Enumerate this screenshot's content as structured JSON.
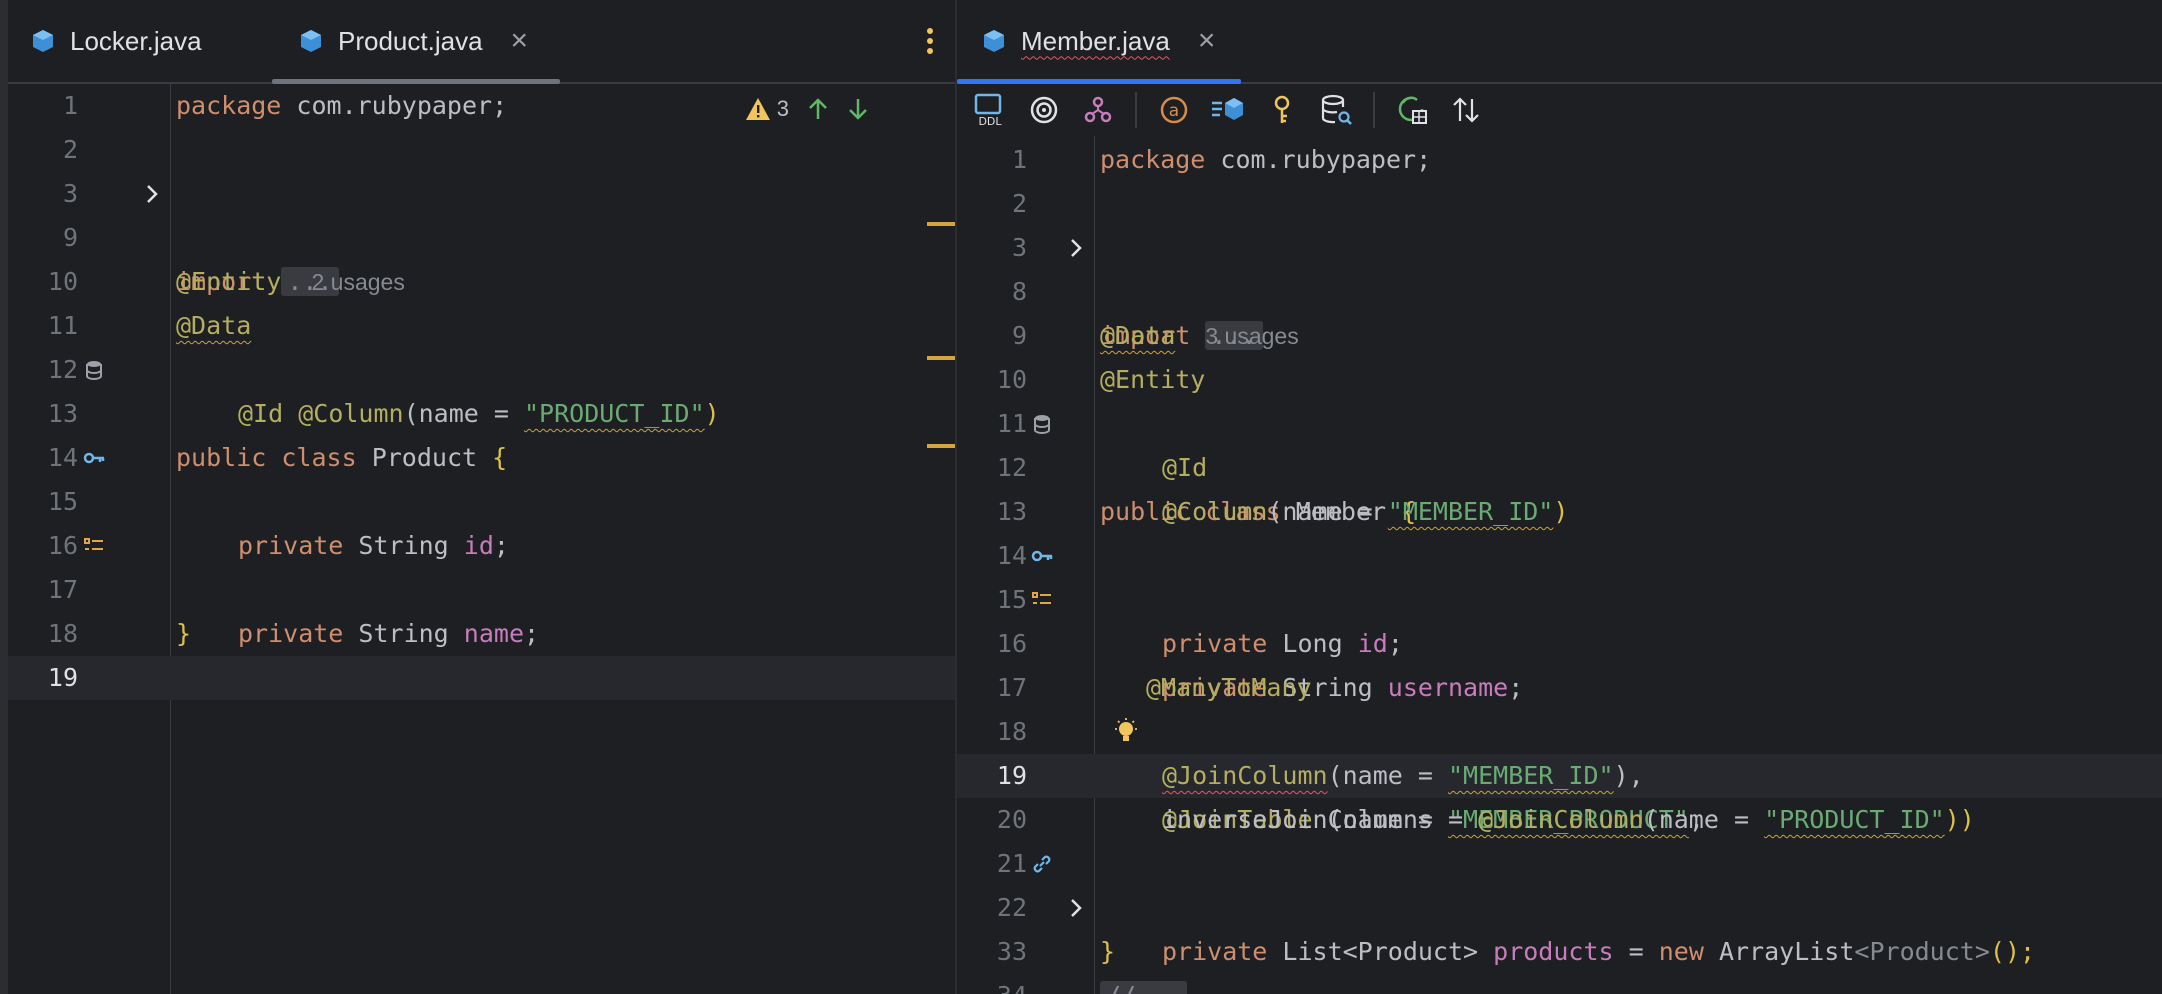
{
  "left_editor": {
    "tabs": [
      {
        "label": "Locker.java",
        "active": false
      },
      {
        "label": "Product.java",
        "active": true
      }
    ],
    "close_glyph": "×",
    "warnings_count": "3",
    "lines": [
      {
        "num": "1"
      },
      {
        "num": "2"
      },
      {
        "num": "3"
      },
      {
        "num": "9"
      },
      {
        "num": "10"
      },
      {
        "num": "11"
      },
      {
        "num": "12"
      },
      {
        "num": "13"
      },
      {
        "num": "14"
      },
      {
        "num": "15"
      },
      {
        "num": "16"
      },
      {
        "num": "17"
      },
      {
        "num": "18"
      },
      {
        "num": "19"
      }
    ],
    "code": {
      "package_kw": "package",
      "package_name": "com.rubypaper;",
      "import_kw": "import",
      "folded": "...",
      "entity": "@Entity",
      "entity_hint": "2 usages",
      "data": "@Data",
      "public_kw": "public",
      "class_kw": "class",
      "class_name": "Product",
      "open_brace": "{",
      "id_ann": "@Id",
      "column_ann": "@Column",
      "column_open": "(name = ",
      "column_str": "\"PRODUCT_ID\"",
      "column_close": ")",
      "private_kw": "private",
      "string_type": "String",
      "id_field": "id",
      "semi": ";",
      "name_field": "name",
      "close_brace": "}"
    }
  },
  "right_editor": {
    "tabs": [
      {
        "label": "Member.java",
        "active": true
      }
    ],
    "close_glyph": "×",
    "toolbar": [
      {
        "icon": "ddl-icon",
        "label": "DDL"
      },
      {
        "icon": "target-icon"
      },
      {
        "icon": "diagram-icon"
      },
      {
        "icon": "at-sign-icon"
      },
      {
        "icon": "entity-list-icon"
      },
      {
        "icon": "key-icon"
      },
      {
        "icon": "db-search-icon"
      },
      {
        "icon": "refresh-db-icon"
      },
      {
        "icon": "sort-icon"
      }
    ],
    "lines": [
      {
        "num": "1"
      },
      {
        "num": "2"
      },
      {
        "num": "3"
      },
      {
        "num": "8"
      },
      {
        "num": "9"
      },
      {
        "num": "10"
      },
      {
        "num": "11"
      },
      {
        "num": "12"
      },
      {
        "num": "13"
      },
      {
        "num": "14"
      },
      {
        "num": "15"
      },
      {
        "num": "16"
      },
      {
        "num": "17"
      },
      {
        "num": "18"
      },
      {
        "num": "19"
      },
      {
        "num": "20"
      },
      {
        "num": "21"
      },
      {
        "num": "22"
      },
      {
        "num": "33"
      },
      {
        "num": "34"
      }
    ],
    "code": {
      "package_kw": "package",
      "package_name": "com.rubypaper;",
      "import_kw": "import",
      "folded": "...",
      "data": "@Data",
      "data_hint": "3 usages",
      "entity": "@Entity",
      "public_kw": "public",
      "class_kw": "class",
      "class_name": "Member",
      "open_brace": "{",
      "id_ann": "@Id",
      "column_ann": "@Column",
      "column_open": "(name = ",
      "column_str": "\"MEMBER_ID\"",
      "column_close": ")",
      "private_kw": "private",
      "long_type": "Long",
      "id_field": "id",
      "semi": ";",
      "string_type": "String",
      "username_field": "username",
      "many_to_many": "@ManyToMany",
      "join_table": "@JoinTable",
      "join_table_open": " (name = ",
      "join_table_str": "\"MEMBER_PRODUCT\"",
      "comma": ",",
      "join_column": "@JoinColumn",
      "join_column_open": "(name = ",
      "join_column_str": "\"MEMBER_ID\"",
      "join_column_close": "),",
      "inverse": "inverseJoinColumns = ",
      "inverse_jc": "@JoinColumn",
      "inverse_open": "(name = ",
      "inverse_str": "\"PRODUCT_ID\"",
      "inverse_close": "))",
      "list_type": "List<Product>",
      "products_field": "products",
      "assign": " = ",
      "new_kw": "new",
      "arraylist": "ArrayList",
      "generic": "<Product>",
      "ctor_end": "();",
      "comment_fold": "//...",
      "close_brace": "}"
    }
  },
  "colors": {
    "keyword": "#cf8e6d",
    "annotation": "#b3ae60",
    "string": "#6aab73",
    "field": "#c77dbb",
    "accent_tab": "#3574f0",
    "warning": "#f2c55c"
  }
}
